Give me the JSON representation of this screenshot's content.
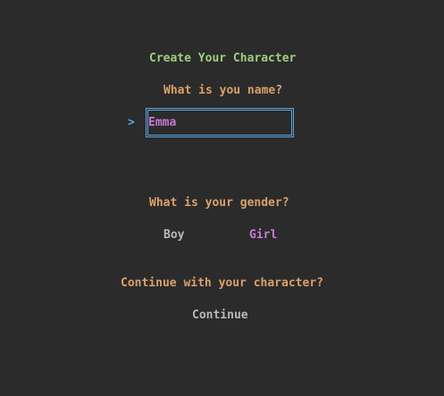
{
  "form": {
    "title": "Create Your Character",
    "name_question": "What is you name?",
    "prompt_symbol": ">",
    "name_value": "Emma",
    "gender_question": "What is your gender?",
    "gender_options": [
      "Boy",
      "Girl"
    ],
    "gender_selected": "Girl",
    "continue_question": "Continue with your character?",
    "continue_label": "Continue"
  },
  "colors": {
    "background": "#2b2b2b",
    "title": "#9ccf80",
    "question": "#d9a06a",
    "focus_border": "#5aa6e2",
    "selected": "#c878d8",
    "unselected": "#b8b8b8"
  }
}
